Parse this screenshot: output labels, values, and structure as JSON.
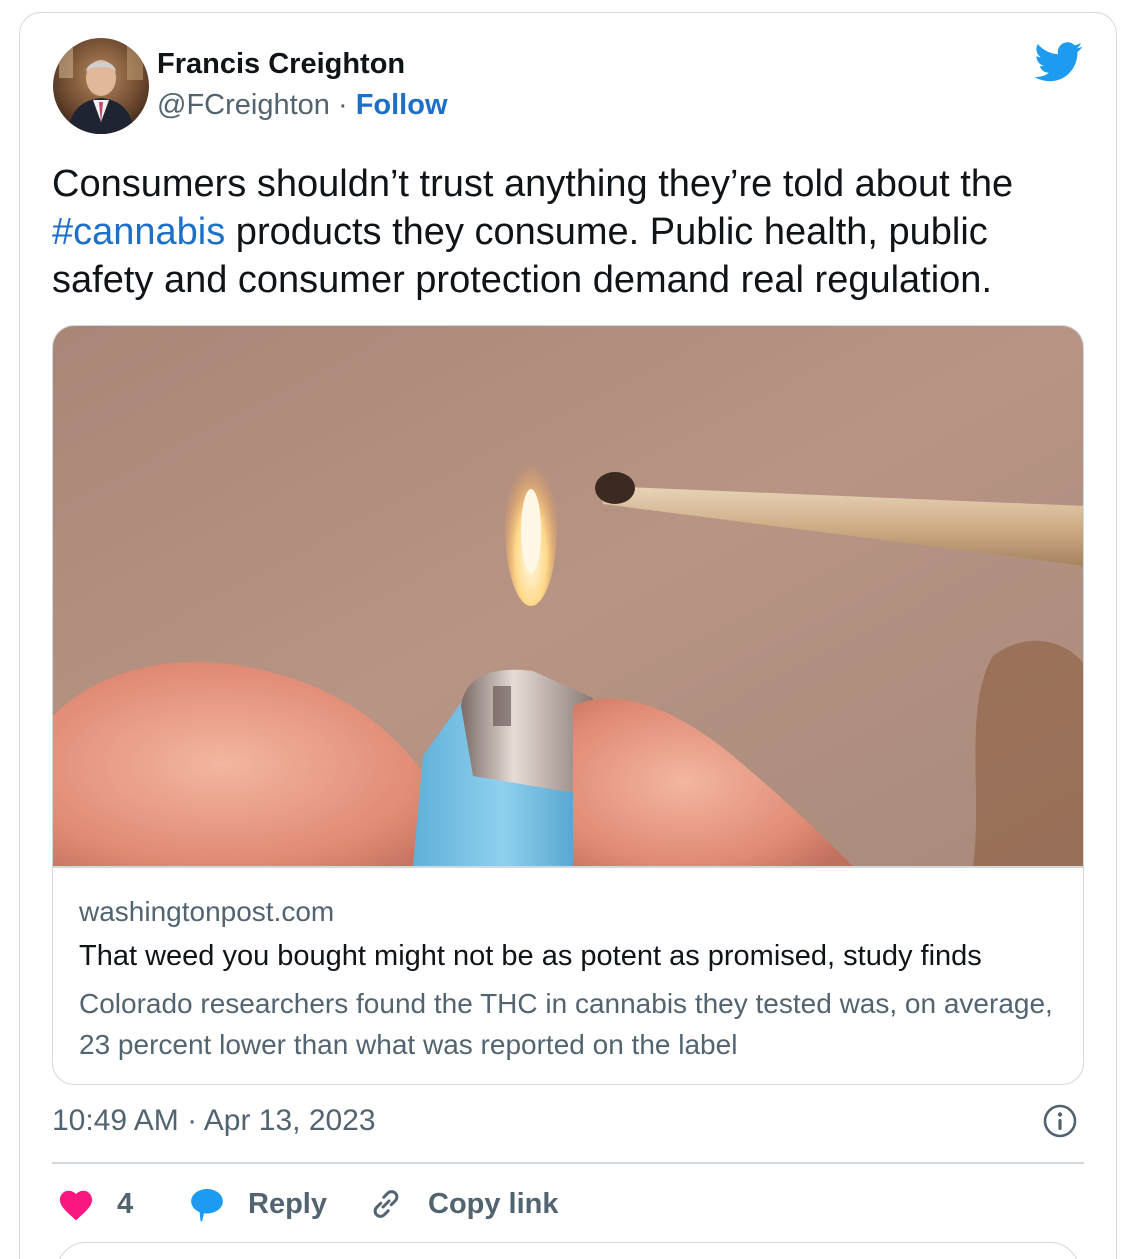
{
  "author": {
    "name": "Francis Creighton",
    "handle": "@FCreighton",
    "separator": " · ",
    "follow_label": "Follow"
  },
  "tweet": {
    "text_before": "Consumers shouldn’t trust anything they’re told about the ",
    "hashtag": "#cannabis",
    "text_after": " products they consume. Public health, public safety and consumer protection demand real regulation."
  },
  "link_card": {
    "domain": "washingtonpost.com",
    "title": "That weed you bought might not be as potent as promised, study finds",
    "description": "Colorado researchers found the THC in cannabis they tested was, on average, 23 percent lower than what was reported on the label"
  },
  "meta": {
    "timestamp": "10:49 AM · Apr 13, 2023"
  },
  "actions": {
    "like_count": "4",
    "reply_label": "Reply",
    "copy_link_label": "Copy link"
  },
  "icons": {
    "brand": "twitter-bird-icon",
    "like": "heart-icon",
    "reply": "speech-bubble-icon",
    "copy": "link-icon",
    "info": "info-icon"
  },
  "colors": {
    "link_blue": "#1d6fc8",
    "brand_blue": "#1d9bf0",
    "like_pink": "#f91880",
    "secondary_text": "#536471",
    "border": "#cfd9de"
  }
}
